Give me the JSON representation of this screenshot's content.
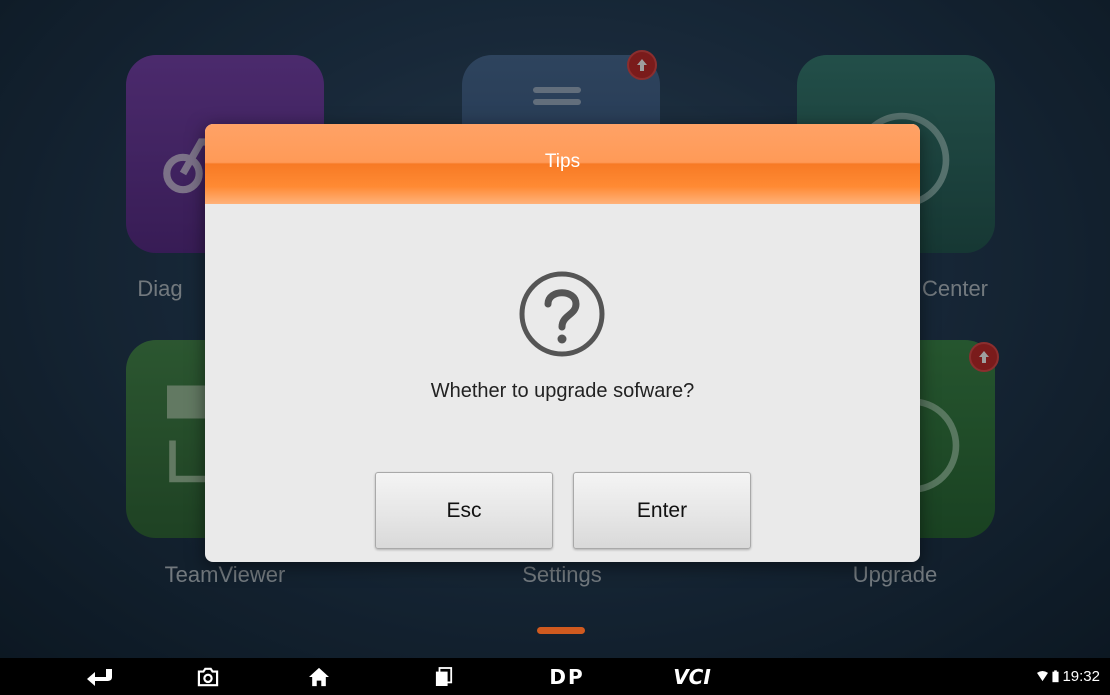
{
  "background_apps": [
    {
      "label": "Diag",
      "icon": "bicycle-icon",
      "color": "#6a3a9c"
    },
    {
      "label": "",
      "icon": "document-icon",
      "color": "#3e5d85",
      "has_badge": true
    },
    {
      "label": "Center",
      "icon": "search-icon",
      "color": "#2f6e66"
    },
    {
      "label": "TeamViewer",
      "icon": "monitor-icon",
      "color": "#3e7a44"
    },
    {
      "label": "Settings",
      "icon": "gear-icon",
      "color": "#55636e"
    },
    {
      "label": "Upgrade",
      "icon": "upgrade-icon",
      "color": "#2f7a40",
      "has_badge": true
    }
  ],
  "dialog": {
    "title": "Tips",
    "message": "Whether to upgrade sofware?",
    "icon": "question-icon",
    "buttons": {
      "esc_label": "Esc",
      "enter_label": "Enter"
    }
  },
  "navbar": {
    "items": [
      "back-icon",
      "camera-icon",
      "home-icon",
      "recent-apps-icon"
    ],
    "dp_label": "DP",
    "vci_label": "VCI",
    "time": "19:32"
  },
  "colors": {
    "header_orange": "#f77a25",
    "badge_red": "#c62d2d",
    "pager_orange": "#d05a1f"
  }
}
